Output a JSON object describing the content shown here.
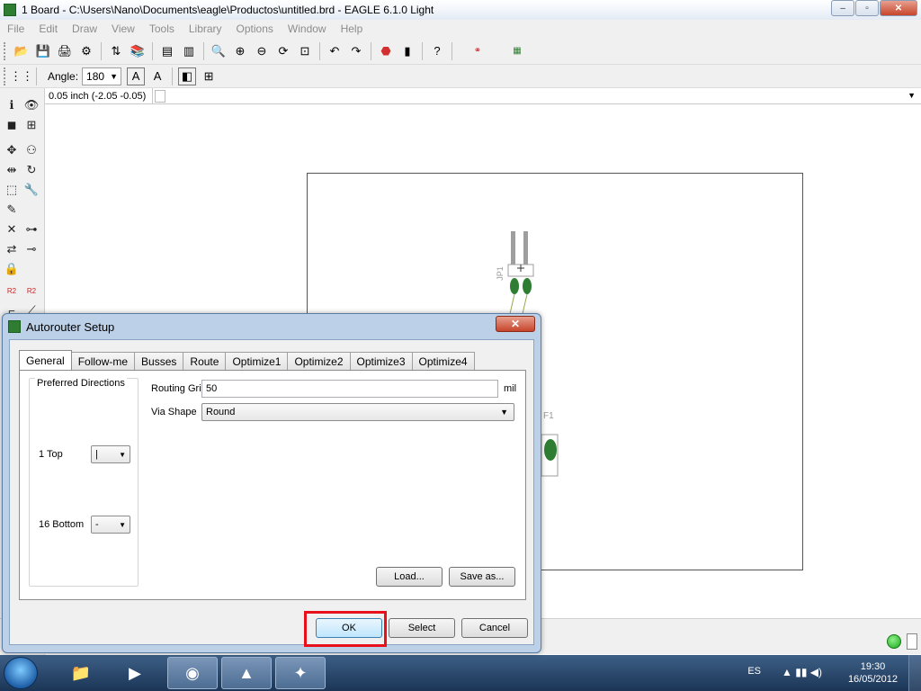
{
  "window": {
    "title": "1 Board - C:\\Users\\Nano\\Documents\\eagle\\Productos\\untitled.brd - EAGLE 6.1.0 Light",
    "minimize": "–",
    "maximize": "▫",
    "close": "✕"
  },
  "menu": [
    "File",
    "Edit",
    "Draw",
    "View",
    "Tools",
    "Library",
    "Options",
    "Window",
    "Help"
  ],
  "toolbar2": {
    "angle_label": "Angle:",
    "angle_value": "180"
  },
  "coords": {
    "display": "0.05 inch (-2.05 -0.05)"
  },
  "canvas": {
    "part1": "JP1",
    "part2": "F1"
  },
  "dialog": {
    "title": "Autorouter Setup",
    "close": "✕",
    "tabs": [
      "General",
      "Follow-me",
      "Busses",
      "Route",
      "Optimize1",
      "Optimize2",
      "Optimize3",
      "Optimize4"
    ],
    "preferred_directions": {
      "title": "Preferred Directions",
      "top_label": "1  Top",
      "top_value": "|",
      "bottom_label": "16  Bottom",
      "bottom_value": "-"
    },
    "routing_grid": {
      "label": "Routing Grid",
      "value": "50",
      "unit": "mil"
    },
    "via_shape": {
      "label": "Via Shape",
      "value": "Round"
    },
    "buttons": {
      "load": "Load...",
      "save_as": "Save as...",
      "ok": "OK",
      "select": "Select",
      "cancel": "Cancel"
    }
  },
  "taskbar": {
    "language": "ES",
    "time": "19:30",
    "date": "16/05/2012"
  },
  "colors": {
    "highlight": "#e8101a",
    "status_led": "#1aa81a",
    "trace": "#2e7d32"
  }
}
